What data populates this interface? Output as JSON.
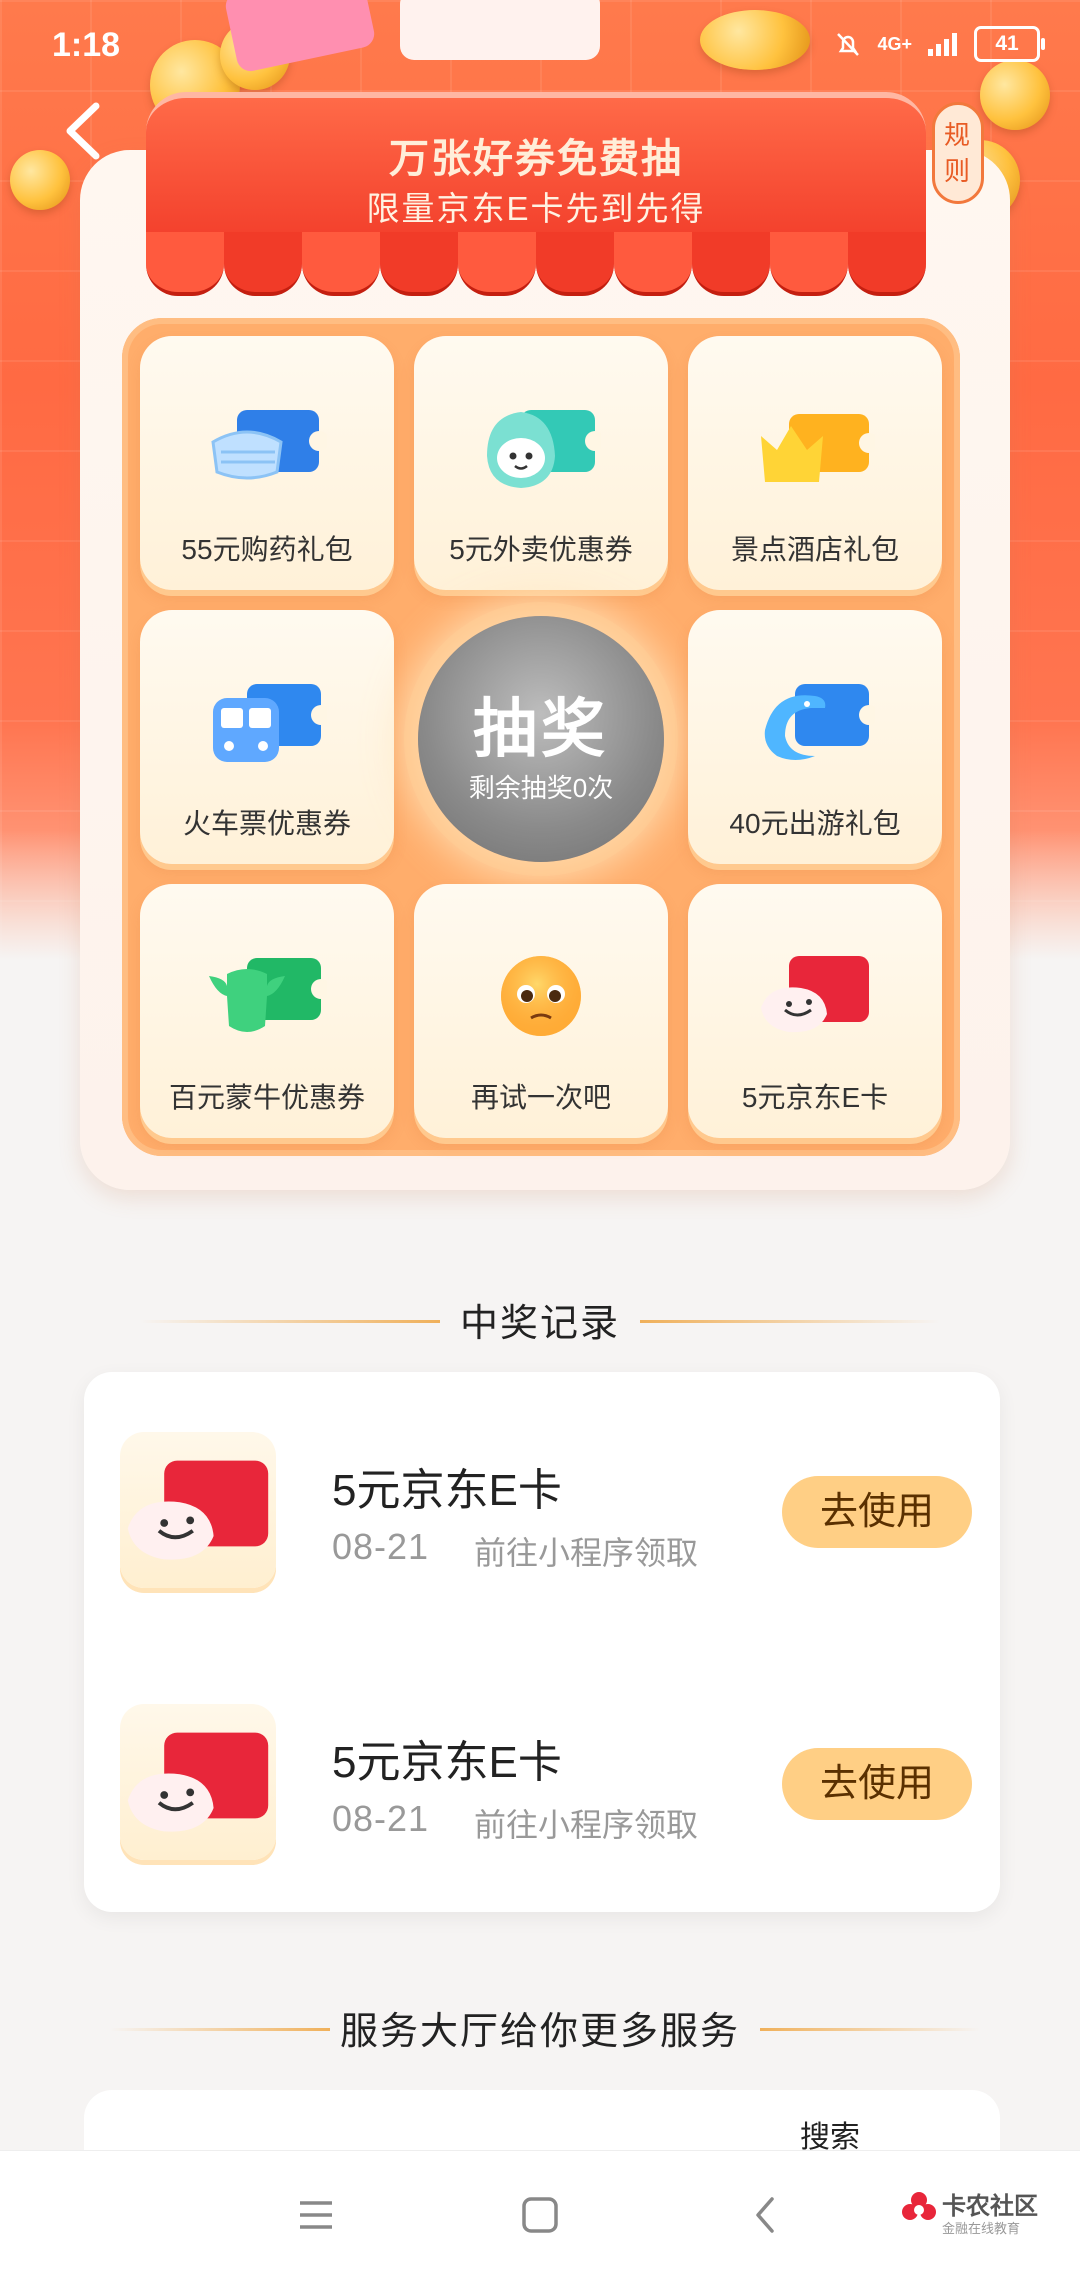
{
  "status_bar": {
    "time": "1:18",
    "network": "4G+",
    "battery": "41"
  },
  "header": {
    "rules_label": "规则",
    "title": "万张好券免费抽",
    "subtitle": "限量京东E卡先到先得"
  },
  "lottery": {
    "prizes": [
      {
        "label": "55元购药礼包",
        "icon": "mask-ticket-icon"
      },
      {
        "label": "5元外卖优惠券",
        "icon": "mascot-ticket-icon"
      },
      {
        "label": "景点酒店礼包",
        "icon": "crown-ticket-icon"
      },
      {
        "label": "火车票优惠券",
        "icon": "train-ticket-icon"
      },
      {
        "label": "40元出游礼包",
        "icon": "dolphin-ticket-icon"
      },
      {
        "label": "百元蒙牛优惠券",
        "icon": "cow-ticket-icon"
      },
      {
        "label": "再试一次吧",
        "icon": "pleading-face-icon"
      },
      {
        "label": "5元京东E卡",
        "icon": "jd-card-icon"
      }
    ],
    "draw_button": {
      "label": "抽奖",
      "remaining": "剩余抽奖0次"
    }
  },
  "records": {
    "title": "中奖记录",
    "items": [
      {
        "name": "5元京东E卡",
        "date": "08-21",
        "desc": "前往小程序领取",
        "action": "去使用",
        "icon": "jd-card-icon"
      },
      {
        "name": "5元京东E卡",
        "date": "08-21",
        "desc": "前往小程序领取",
        "action": "去使用",
        "icon": "jd-card-icon"
      }
    ]
  },
  "services": {
    "title": "服务大厅给你更多服务",
    "search_label": "搜索"
  },
  "watermark": {
    "title": "卡农社区",
    "subtitle": "金融在线教育"
  },
  "colors": {
    "primary": "#ff6a43",
    "button": "#ffcf85",
    "board": "#ffad6b"
  }
}
